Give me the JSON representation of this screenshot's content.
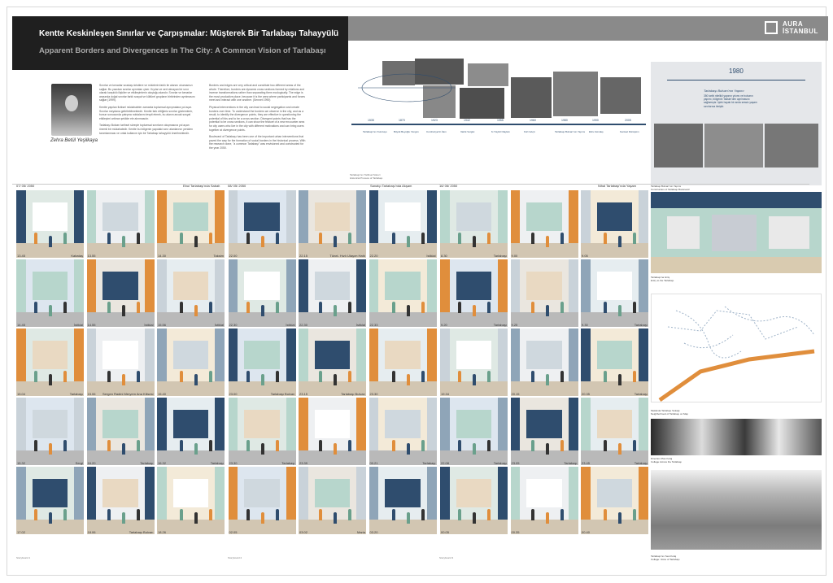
{
  "header": {
    "title_tr": "Kentte Keskinleşen Sınırlar ve Çarpışmalar: Müşterek Bir Tarlabaşı Tahayyülü",
    "title_en": "Apparent Borders and Divergences In The City: A Common Vision of Tarlabaşı",
    "logo_line1": "AURA",
    "logo_line2": "İSTANBUL"
  },
  "author": {
    "name": "Zehra Betül Yeşilkaya"
  },
  "text": {
    "col1_paragraphs": [
      "Sınırlar ve kenarlar sıradaşı kristlere ve mülzlerin farklı ile alanını okumamızı sağlar. Bu yazıdan sınırlar ayrımları çizer. Kıyılar ve sert olmayan bir sınır olarak karşılıklı ilişkiler ve etkileşimlerin oluştuğu alandır. Sınırlar ve kenarlar arasında doğal sınırlar farklı sosyal ve kültürel grupların birbirinden ayrılmasını sağlar (1999).",
      "Kentte yapılan fiziksel müdahaleler zamanla toplumsal ayrışmalara yol açar. Sınırlar meydana getirilebilmektedir. Kentte fark ettiğimiz sınırlar gözlemlenir, bunun sonucunda çatışma noktalarını tespit etmek, bu alanın ancak sosyal etkileşimi arttıran şekilde ele alınmasıdır.",
      "Tarlabaşı Bulvarı tarihsel süreçte toplumsal sınırların oluşmasına yol açan önemli bir müdahaledir. Kentte bu bölgenin yapıdaki sınır alanlarının yeniden tanımlanması ve ortak kullanım için bir Tarlabaşı tahayyülü önerilmektedir."
    ],
    "col2_paragraphs": [
      "Borders and edges are very critical and constitute two different areas of the whole. Therefore, borders are dynamic cross sections formed by relations and inverse transformations rather than separating them ecologically. The edge is the most productive place, because it is the area where participants and forces meet and interact with one another. (Sennet 1990)",
      "Physical interventions in the city can lead to social segregation and create borders over time. To understand the borders we observe in the city, and as a result, to identify the divergence points, they are effective in questioning the potential of this and to be a cross section. Divergent points that has the potential to be cross sections, it can show the feature of a new encounter area for city users who live in the city with different motivations and can bring users together at divergence points.",
      "Boulevard of Tarlabaşı has been one of the important urban interventions that paved the way for the formation of social borders in the historical process. With the research done, \"a common Tarlabaşı\" was envisioned and constructed for the year 2050."
    ]
  },
  "timeline": {
    "labels": [
      "Tarlabaşı'nın Kuruluşu",
      "Büyük Beyoğlu Yangını",
      "Cumhuriyet'in İlanı",
      "Varlık Vergisi",
      "6-7 Eylül Olayları",
      "Kürt Göçü",
      "Tarlabaşı Bulvarı'nın Yapımı",
      "Ebru Gündeş",
      "Kentsel Dönüşüm"
    ],
    "years": [
      "1535",
      "1870",
      "1923",
      "1942",
      "1955",
      "1960",
      "1980",
      "1990",
      "2005"
    ],
    "caption_tr": "Tarlabaşı'nın Tarihsel Süreci",
    "caption_en": "Historical Process of Tarlabaşı"
  },
  "right_top": {
    "year": "1980",
    "title": "Tarlabaşı Bulvarı'nın Yapımı",
    "desc": "350 tarihi nitelikli yapının yıkımı ve bulvarın yapımı, bölgenin Taksim'den ayrılmasını sağlamıştır. İşlek hayatı bir anda sessiz yaşam sınırlarına itmiştir."
  },
  "grid": {
    "col_headers": [
      {
        "date": "07/ 05/ 2050",
        "place": "Ebul Tarlabaşı'nda Sabah"
      },
      {
        "date": "08/ 05/ 2050",
        "place": "Sanatçı Tarlabaşı'nda Akşam"
      },
      {
        "date": "16/ 06/ 2050",
        "place": "Nihal Tarlabaşı'nda Yaşam"
      }
    ],
    "row_captions": [
      "Storyboard 1",
      "Storyboard 2",
      "Storyboard 3"
    ],
    "rows": [
      [
        {
          "time": "13.45",
          "place": "Kabataş"
        },
        {
          "time": "13.55",
          "place": ""
        },
        {
          "time": "14.30",
          "place": "Taksim"
        },
        {
          "time": "22.00",
          "place": ""
        },
        {
          "time": "22.15",
          "place": "Tünel- Hızlı Ulaşım Hattı"
        },
        {
          "time": "22.20",
          "place": "İstiklal"
        },
        {
          "time": "8.30",
          "place": "Tarlabaşı"
        },
        {
          "time": "9.00",
          "place": ""
        },
        {
          "time": "9.05",
          "place": ""
        }
      ],
      [
        {
          "time": "14.45",
          "place": "İstiklal"
        },
        {
          "time": "14.55",
          "place": "İstiklal"
        },
        {
          "time": "15.56",
          "place": "İstiklal"
        },
        {
          "time": "22.30",
          "place": "İstiklal"
        },
        {
          "time": "22.30",
          "place": "İstiklal"
        },
        {
          "time": "22.33",
          "place": ""
        },
        {
          "time": "9.20",
          "place": "Tarlabaşı"
        },
        {
          "time": "9.25",
          "place": ""
        },
        {
          "time": "9.30",
          "place": "Tarlabaşı"
        }
      ],
      [
        {
          "time": "15.04",
          "place": "Tarlabaşı"
        },
        {
          "time": "15.06",
          "place": "Sergen Radini Meryem Ana Kilisesi"
        },
        {
          "time": "15.40",
          "place": ""
        },
        {
          "time": "23.00",
          "place": "Tarlabaşı Bulvarı"
        },
        {
          "time": "23.15",
          "place": "Tarlabaşı Bulvarı"
        },
        {
          "time": "23.30",
          "place": ""
        },
        {
          "time": "19.34",
          "place": ""
        },
        {
          "time": "20.15",
          "place": ""
        },
        {
          "time": "20.35",
          "place": "Tarlabaşı"
        }
      ],
      [
        {
          "time": "15.32",
          "place": "Sergi"
        },
        {
          "time": "16.20",
          "place": "Tarlabaşı"
        },
        {
          "time": "16.32",
          "place": "Tarlabaşı"
        },
        {
          "time": "23.30",
          "place": "Tarlabaşı"
        },
        {
          "time": "23.39",
          "place": ""
        },
        {
          "time": "00.21",
          "place": "Tarlabaşı"
        },
        {
          "time": "22.08",
          "place": "Tarlabaşı"
        },
        {
          "time": "23.05",
          "place": "Tarlabaşı"
        },
        {
          "time": "23.45",
          "place": "Tarlabaşı"
        }
      ],
      [
        {
          "time": "17.02",
          "place": ""
        },
        {
          "time": "18.06",
          "place": "Tarlabaşı Bulvarı"
        },
        {
          "time": "18.26",
          "place": ""
        },
        {
          "time": "02.05",
          "place": ""
        },
        {
          "time": "03.02",
          "place": "Maria"
        },
        {
          "time": "03.20",
          "place": ""
        },
        {
          "time": "00.05",
          "place": ""
        },
        {
          "time": "00.35",
          "place": ""
        },
        {
          "time": "00.40",
          "place": ""
        }
      ]
    ]
  },
  "side": {
    "caption1_tr": "Tarlabaşı Bulvarı'nın Yapımı",
    "caption1_en": "Construction of Tarlabaşı Boulevard",
    "caption2_tr": "Tarlabaşı'na Giriş",
    "caption2_en": "Entry to the Tarlabaşı",
    "caption3_tr": "Mekânda Tarlabaşı Sokağı",
    "caption3_en": "Neighborhood of Tarlabaşı on Map",
    "caption4_tr": "Direction Plan Kolaj",
    "caption4_en": "Collage Across the Tarlabaşı",
    "caption5_tr": "Tarlabaşı'nın Sesi Kolaj",
    "caption5_en": "Collage: Voice of Tarlabaşı"
  },
  "colors": {
    "navy": "#2f4d6e",
    "orange": "#e08e3c",
    "mint": "#b7d6cc",
    "title_bg": "#1f1f1f"
  }
}
